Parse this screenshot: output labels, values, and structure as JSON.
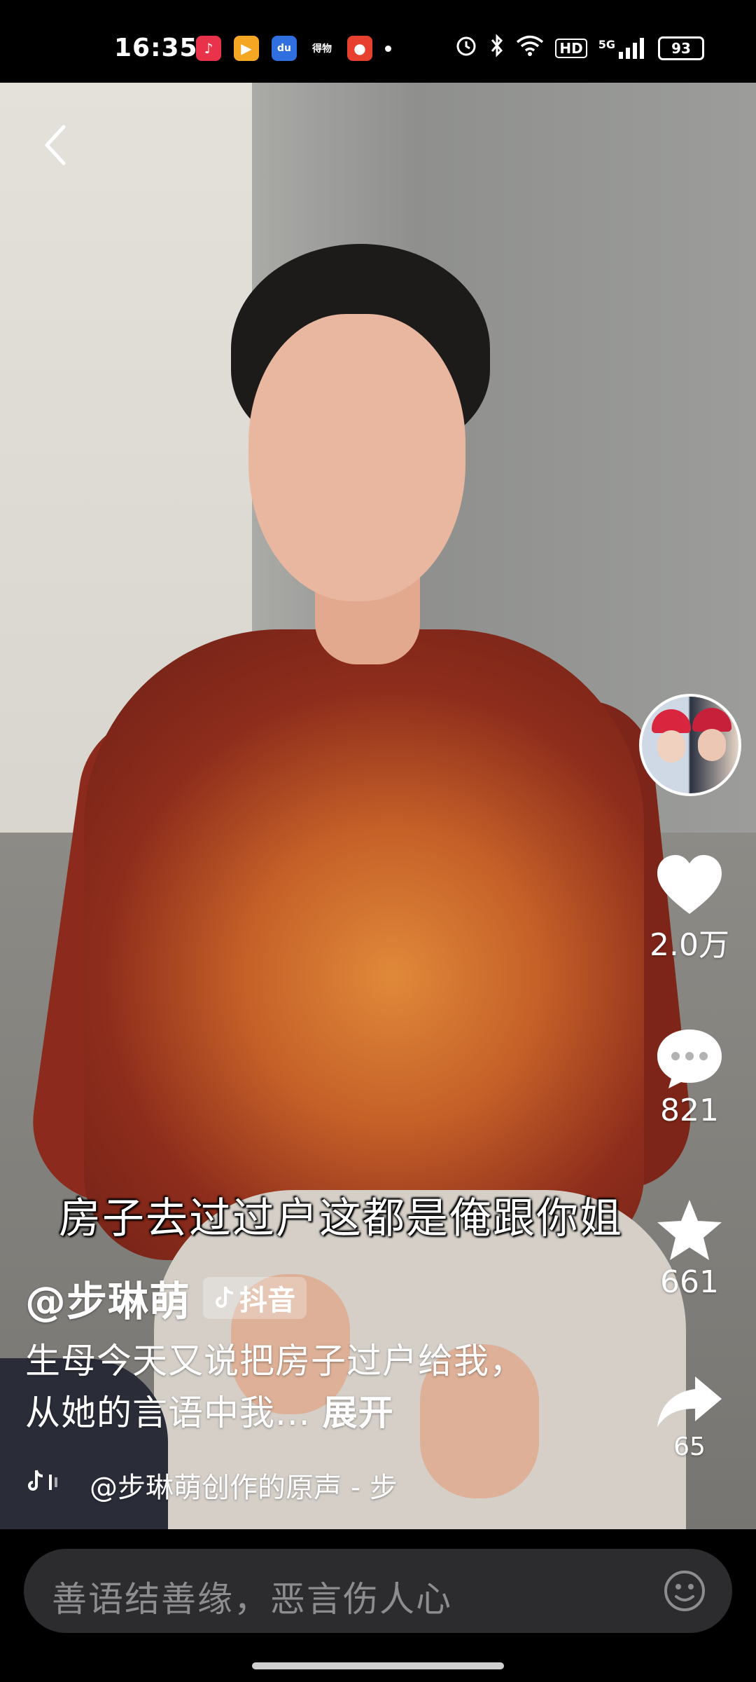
{
  "status_bar": {
    "time": "16:35",
    "app_icons": [
      {
        "name": "music-app-icon",
        "glyph": "♪",
        "bg": "#e8334a"
      },
      {
        "name": "video-app-icon",
        "glyph": "▶",
        "bg": "#f5a623"
      },
      {
        "name": "baidu-app-icon",
        "glyph": "du",
        "bg": "#2f6fe0"
      },
      {
        "name": "shopping-app-icon",
        "glyph": "得物",
        "bg": "#000000"
      },
      {
        "name": "news-app-icon",
        "glyph": "●",
        "bg": "#e8402e"
      }
    ],
    "network_5g": "5G",
    "hd": "HD",
    "battery": "93"
  },
  "caption": "房子去过过户这都是俺跟你姐",
  "side_actions": {
    "likes": "2.0万",
    "comments": "821",
    "favorites": "661",
    "shares": "65"
  },
  "post": {
    "author": "@步琳萌",
    "platform": "抖音",
    "description": "生母今天又说把房子过户给我，从她的言语中我...",
    "expand": "展开",
    "music": "@步琳萌创作的原声 - 步"
  },
  "comment_bar": {
    "placeholder": "善语结善缘，恶言伤人心"
  },
  "colors": {
    "background": "#000000",
    "accent_helmet": "#d9253d",
    "comment_box": "#2c2c2e"
  }
}
